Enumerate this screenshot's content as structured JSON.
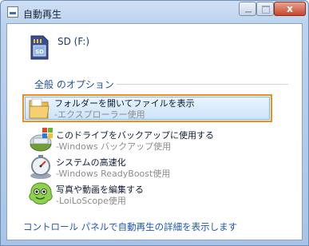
{
  "window": {
    "title": "自動再生",
    "close_glyph": "x"
  },
  "drive": {
    "label": "SD (F:)",
    "icon": "sd-card-icon"
  },
  "section": {
    "title": "全般 のオプション"
  },
  "options": [
    {
      "title": "フォルダーを開いてファイルを表示",
      "subtitle": "-エクスプローラー使用",
      "icon": "folder-icon",
      "highlighted": true
    },
    {
      "title": "このドライブをバックアップに使用する",
      "subtitle": "-Windows バックアップ使用",
      "icon": "backup-icon"
    },
    {
      "title": "システムの高速化",
      "subtitle": "-Windows ReadyBoost使用",
      "icon": "readyboost-icon"
    },
    {
      "title": "写真や動画を編集する",
      "subtitle": "-LoiLoScope使用",
      "icon": "loiloscope-icon"
    }
  ],
  "footer": {
    "link": "コントロール パネルで自動再生の詳細を表示します"
  },
  "colors": {
    "highlight_border": "#f08c1a",
    "link": "#1f56b8",
    "section_title": "#1e4fa0"
  }
}
